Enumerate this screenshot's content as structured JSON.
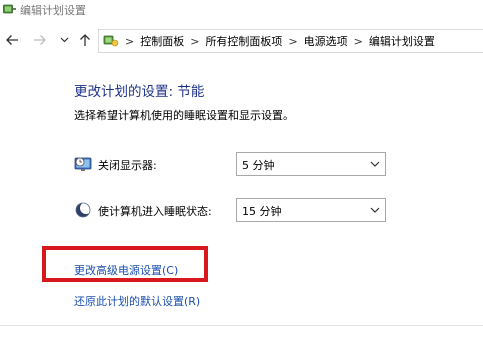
{
  "window": {
    "title": "编辑计划设置",
    "icon": "power-options-icon"
  },
  "nav": {
    "back_icon": "arrow-left-icon",
    "forward_icon": "arrow-right-icon",
    "recent_icon": "chevron-down-icon",
    "up_icon": "arrow-up-icon"
  },
  "address": {
    "icon": "control-panel-icon",
    "separator": ">",
    "crumbs": [
      "控制面板",
      "所有控制面板项",
      "电源选项",
      "编辑计划设置"
    ]
  },
  "main": {
    "heading": "更改计划的设置: 节能",
    "subheading": "选择希望计算机使用的睡眠设置和显示设置。",
    "settings": [
      {
        "label": "关闭显示器:",
        "icon": "monitor-clock-icon",
        "value": "5 分钟"
      },
      {
        "label": "使计算机进入睡眠状态:",
        "icon": "moon-sleep-icon",
        "value": "15 分钟"
      }
    ],
    "links": {
      "advanced": "更改高级电源设置(C)",
      "restore": "还原此计划的默认设置(R)"
    }
  },
  "colors": {
    "heading": "#1e3287",
    "link": "#1a4fb0",
    "highlight": "#d7191e"
  }
}
